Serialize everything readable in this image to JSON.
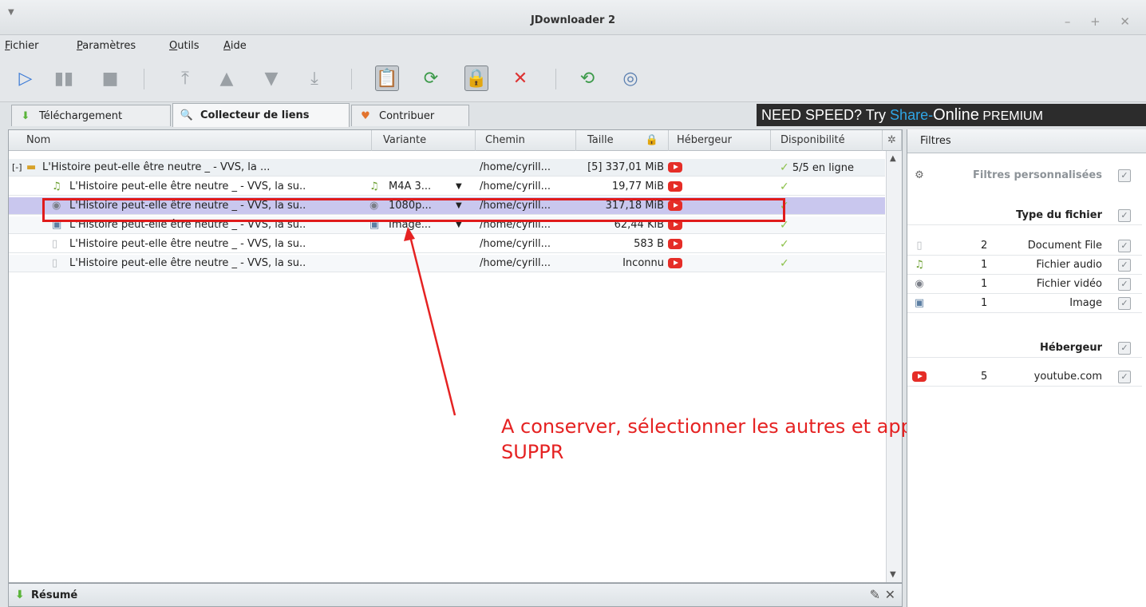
{
  "window": {
    "title": "JDownloader 2",
    "controls": "– + ✕"
  },
  "menu": [
    {
      "first": "F",
      "rest": "ichier"
    },
    {
      "first": "P",
      "rest": "aramètres"
    },
    {
      "first": "O",
      "rest": "utils"
    },
    {
      "first": "A",
      "rest": "ide"
    }
  ],
  "tabs": [
    {
      "label": "Téléchargement"
    },
    {
      "label": "Collecteur de liens"
    },
    {
      "label": "Contribuer"
    }
  ],
  "ad": {
    "prefix": "NEED SPEED? Try ",
    "share": "Share-",
    "online": "Online",
    "premium": " PREMIUM"
  },
  "columns": {
    "name": "Nom",
    "variant": "Variante",
    "path": "Chemin",
    "size": "Taille",
    "host": "Hébergeur",
    "availability": "Disponibilité"
  },
  "package": {
    "expander": "[-]",
    "name": "L'Histoire peut-elle être neutre _ - VVS, la ...",
    "path": "/home/cyrill...",
    "size": "[5] 337,01 MiB",
    "availability": "5/5 en ligne"
  },
  "rows": [
    {
      "name": "L'Histoire peut-elle être neutre _ - VVS, la su..",
      "variant": "M4A 3...",
      "has_dropdown": true,
      "path": "/home/cyrill...",
      "size": "19,77 MiB",
      "icon": "audio-icon"
    },
    {
      "name": "L'Histoire peut-elle être neutre _ - VVS, la su..",
      "variant": "1080p...",
      "has_dropdown": true,
      "path": "/home/cyrill...",
      "size": "317,18 MiB",
      "icon": "video-icon",
      "selected": true
    },
    {
      "name": "L'Histoire peut-elle être neutre _ - VVS, la su..",
      "variant": "Image...",
      "has_dropdown": true,
      "path": "/home/cyrill...",
      "size": "62,44 KiB",
      "icon": "image-icon"
    },
    {
      "name": "L'Histoire peut-elle être neutre _ - VVS, la su..",
      "variant": "",
      "has_dropdown": false,
      "path": "/home/cyrill...",
      "size": "583 B",
      "icon": "document-icon"
    },
    {
      "name": "L'Histoire peut-elle être neutre _ - VVS, la su..",
      "variant": "",
      "has_dropdown": false,
      "path": "/home/cyrill...",
      "size": "Inconnu",
      "icon": "document-icon"
    }
  ],
  "annotation": {
    "line1": "A conserver, sélectionner les autres et appuyer sur",
    "line2": "SUPPR"
  },
  "summary": {
    "title": "Résumé"
  },
  "filters": {
    "title": "Filtres",
    "custom": "Filtres personnalisées",
    "type_header": "Type du fichier",
    "types": [
      {
        "count": "2",
        "name": "Document File"
      },
      {
        "count": "1",
        "name": "Fichier audio"
      },
      {
        "count": "1",
        "name": "Fichier vidéo"
      },
      {
        "count": "1",
        "name": "Image"
      }
    ],
    "host_header": "Hébergeur",
    "hosts": [
      {
        "count": "5",
        "name": "youtube.com"
      }
    ]
  },
  "colors": {
    "highlight": "#e01b1b",
    "annotation": "#e52222",
    "selected_row": "#c9c7ee",
    "youtube": "#e52d27"
  }
}
